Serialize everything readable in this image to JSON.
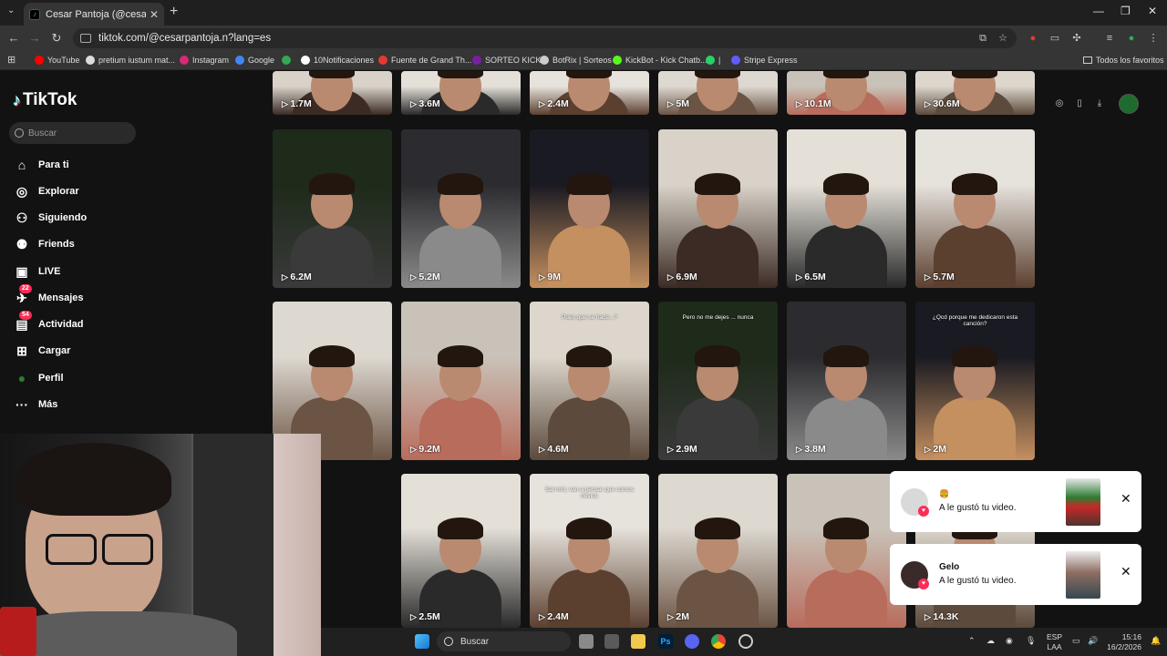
{
  "browser": {
    "tab_title": "Cesar Pantoja (@cesarpantoja...",
    "url": "tiktok.com/@cesarpantoja.n?lang=es",
    "bookmarks": [
      {
        "label": "YouTube",
        "color": "#ff0000"
      },
      {
        "label": "pretium iustum mat...",
        "color": "#dddddd"
      },
      {
        "label": "Instagram",
        "color": "#d62976"
      },
      {
        "label": "Google",
        "color": "#4285f4"
      },
      {
        "label": "",
        "color": "#34a853"
      },
      {
        "label": "10Notificaciones",
        "color": "#ffffff"
      },
      {
        "label": "Fuente de Grand Th...",
        "color": "#e53935"
      },
      {
        "label": "SORTEO KICK",
        "color": "#7b1fa2"
      },
      {
        "label": "BotRix | Sorteos",
        "color": "#cccccc"
      },
      {
        "label": "KickBot - Kick Chatb...",
        "color": "#53fc18"
      },
      {
        "label": "|",
        "color": "#25d366"
      },
      {
        "label": "Stripe Express",
        "color": "#635bff"
      }
    ],
    "all_bookmarks": "Todos los favoritos"
  },
  "tiktok": {
    "logo": "TikTok",
    "search_placeholder": "Buscar",
    "nav": [
      {
        "label": "Para ti",
        "icon": "home-icon",
        "glyph": "⌂"
      },
      {
        "label": "Explorar",
        "icon": "compass-icon",
        "glyph": "◎"
      },
      {
        "label": "Siguiendo",
        "icon": "following-icon",
        "glyph": "⚇"
      },
      {
        "label": "Friends",
        "icon": "friends-icon",
        "glyph": "⚉"
      },
      {
        "label": "LIVE",
        "icon": "live-icon",
        "glyph": "▣"
      },
      {
        "label": "Mensajes",
        "icon": "messages-icon",
        "glyph": "✈",
        "badge": "22"
      },
      {
        "label": "Actividad",
        "icon": "activity-icon",
        "glyph": "▤",
        "badge": "54"
      },
      {
        "label": "Cargar",
        "icon": "upload-icon",
        "glyph": "⊞"
      },
      {
        "label": "Perfil",
        "icon": "profile-avatar",
        "glyph": "●"
      },
      {
        "label": "Más",
        "icon": "more-icon",
        "glyph": "···"
      }
    ],
    "rows": [
      {
        "views": [
          "1.7M",
          "3.6M",
          "2.4M",
          "5M",
          "10.1M",
          "30.6M"
        ],
        "captions": [
          "",
          "",
          "",
          "",
          "",
          ""
        ]
      },
      {
        "views": [
          "6.2M",
          "5.2M",
          "9M",
          "6.9M",
          "6.5M",
          "5.7M"
        ],
        "captions": [
          "",
          "",
          "",
          "",
          "",
          ""
        ]
      },
      {
        "views": [
          "",
          "9.2M",
          "4.6M",
          "2.9M",
          "3.8M",
          "2M"
        ],
        "captions": [
          "",
          "",
          "Pues que se hace...?",
          "Pero no me dejes ... nunca",
          "",
          "¿Qcd porque me dedicaron esta canción?"
        ]
      },
      {
        "views": [
          "",
          "2.5M",
          "2.4M",
          "2M",
          "",
          "14.3K"
        ],
        "captions": [
          "",
          "",
          "Sal mrd, van a pensar que somos novios",
          "",
          "",
          ""
        ]
      }
    ],
    "notifications": [
      {
        "name": "",
        "message": "A le gustó tu video."
      },
      {
        "name": "Gelo",
        "message": "A le gustó tu video."
      }
    ]
  },
  "taskbar": {
    "search": "Buscar",
    "lang_top": "ESP",
    "lang_bottom": "LAA",
    "time": "15:16",
    "date": "16/2/2026"
  },
  "colors": {
    "accent": "#fe2c55",
    "background": "#121212"
  }
}
